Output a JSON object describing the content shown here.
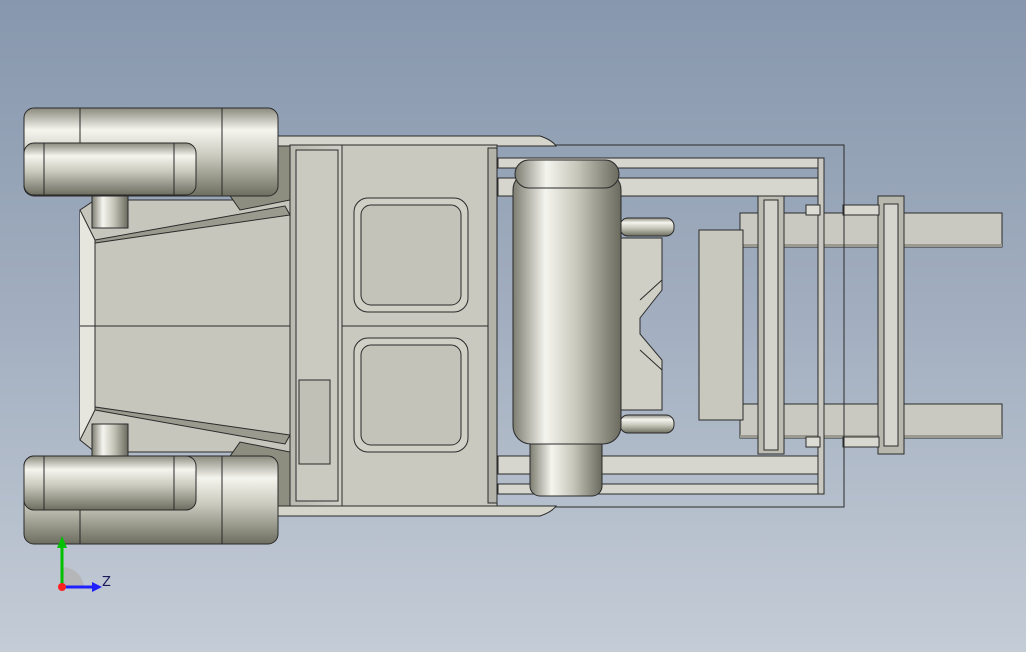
{
  "viewport": {
    "background_top": "#8797ad",
    "background_bottom": "#c4ccd6"
  },
  "model": {
    "body_color": "#c6c6bd",
    "metal_light": "#f4f4ee",
    "metal_dark": "#6f6f62",
    "edge_color": "#2a2a2a"
  },
  "triad": {
    "axis_label_z": "Z",
    "x_color": "#ff2020",
    "y_color": "#00c000",
    "z_color": "#2020ff"
  }
}
